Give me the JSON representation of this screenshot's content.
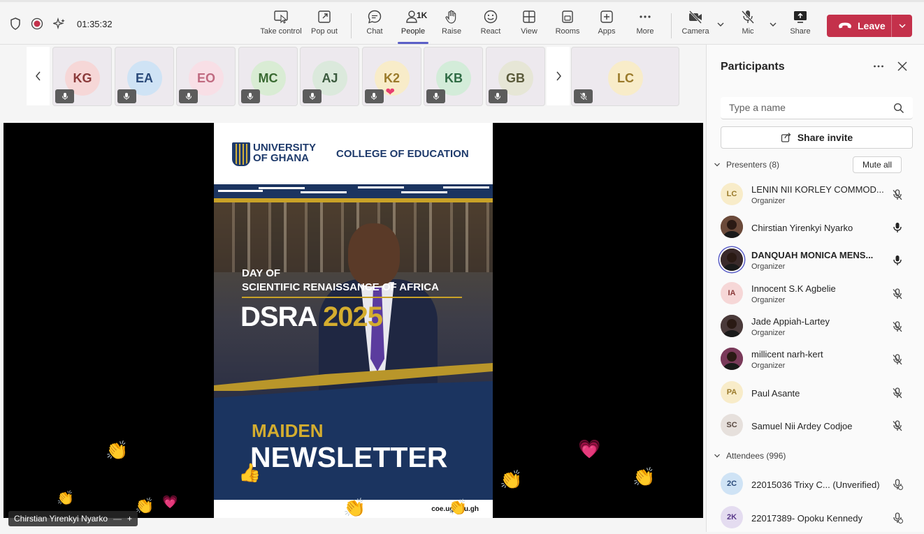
{
  "topbar": {
    "timer": "01:35:32",
    "tools": {
      "take_control": "Take control",
      "pop_out": "Pop out",
      "chat": "Chat",
      "people": "People",
      "people_count": "1K",
      "raise": "Raise",
      "react": "React",
      "view": "View",
      "rooms": "Rooms",
      "apps": "Apps",
      "more": "More",
      "camera": "Camera",
      "mic": "Mic",
      "share": "Share"
    },
    "leave_label": "Leave",
    "accent_color": "#5b5fc7",
    "leave_color": "#c4314b"
  },
  "strip": {
    "tiles": [
      {
        "initials": "KG",
        "bg": "#f6d7d7",
        "fg": "#8a3a3a"
      },
      {
        "initials": "EA",
        "bg": "#cfe3f5",
        "fg": "#2a4a7a"
      },
      {
        "initials": "EO",
        "bg": "#f8dfe6",
        "fg": "#c06a80"
      },
      {
        "initials": "MC",
        "bg": "#d9ecd4",
        "fg": "#3a6a32"
      },
      {
        "initials": "AJ",
        "bg": "#dbe9dc",
        "fg": "#3b5a3e"
      },
      {
        "initials": "K2",
        "bg": "#f8ecc9",
        "fg": "#9a7a2a"
      },
      {
        "initials": "KB",
        "bg": "#d3ecd9",
        "fg": "#2f6b44"
      },
      {
        "initials": "GB",
        "bg": "#e6e6d6",
        "fg": "#5a5a3a"
      }
    ],
    "pinned": {
      "initials": "LC",
      "bg": "#f8ecc9",
      "fg": "#9a7a2a"
    }
  },
  "video": {
    "poster": {
      "university": "UNIVERSITY",
      "university2": "OF GHANA",
      "college": "COLLEGE OF EDUCATION",
      "line1": "DAY OF",
      "line2": "SCIENTIFIC RENAISSANCE OF AFRICA",
      "dsra": "DSRA",
      "year": "2025",
      "maiden": "MAIDEN",
      "newsletter": "NEWSLETTER",
      "url": "coe.ug.edu.gh"
    },
    "presenter_name": "Chirstian Yirenkyi Nyarko"
  },
  "panel": {
    "title": "Participants",
    "search_placeholder": "Type a name",
    "share_invite": "Share invite",
    "presenters_label": "Presenters (8)",
    "mute_all": "Mute all",
    "attendees_label": "Attendees (996)",
    "presenters": [
      {
        "initials": "LC",
        "name": "LENIN NII KORLEY COMMOD...",
        "role": "Organizer",
        "bg": "#f8ecc9",
        "fg": "#9a7a2a",
        "mic": "muted"
      },
      {
        "initials": "",
        "name": "Chirstian Yirenkyi Nyarko",
        "role": "",
        "bg": "#6b4a3a",
        "fg": "#fff",
        "mic": "on"
      },
      {
        "initials": "",
        "name": "DANQUAH MONICA MENS...",
        "role": "Organizer",
        "bg": "#3a2a2a",
        "fg": "#fff",
        "mic": "on"
      },
      {
        "initials": "IA",
        "name": "Innocent S.K Agbelie",
        "role": "Organizer",
        "bg": "#f6d7d7",
        "fg": "#8a3a3a",
        "mic": "muted"
      },
      {
        "initials": "",
        "name": "Jade Appiah-Lartey",
        "role": "Organizer",
        "bg": "#4a3a3a",
        "fg": "#fff",
        "mic": "muted"
      },
      {
        "initials": "",
        "name": "millicent narh-kert",
        "role": "Organizer",
        "bg": "#7a3a5a",
        "fg": "#fff",
        "mic": "muted"
      },
      {
        "initials": "PA",
        "name": "Paul Asante",
        "role": "",
        "bg": "#f8ecc9",
        "fg": "#9a7a2a",
        "mic": "muted"
      },
      {
        "initials": "SC",
        "name": "Samuel Nii Ardey Codjoe",
        "role": "",
        "bg": "#e6e0dc",
        "fg": "#5a4a42",
        "mic": "muted"
      }
    ],
    "attendees": [
      {
        "initials": "2C",
        "name": "22015036 Trixy C... (Unverified)",
        "bg": "#cfe3f5",
        "fg": "#2a4a7a"
      },
      {
        "initials": "2K",
        "name": "22017389- Opoku Kennedy",
        "bg": "#e4dcf0",
        "fg": "#5a3a8a"
      }
    ]
  }
}
